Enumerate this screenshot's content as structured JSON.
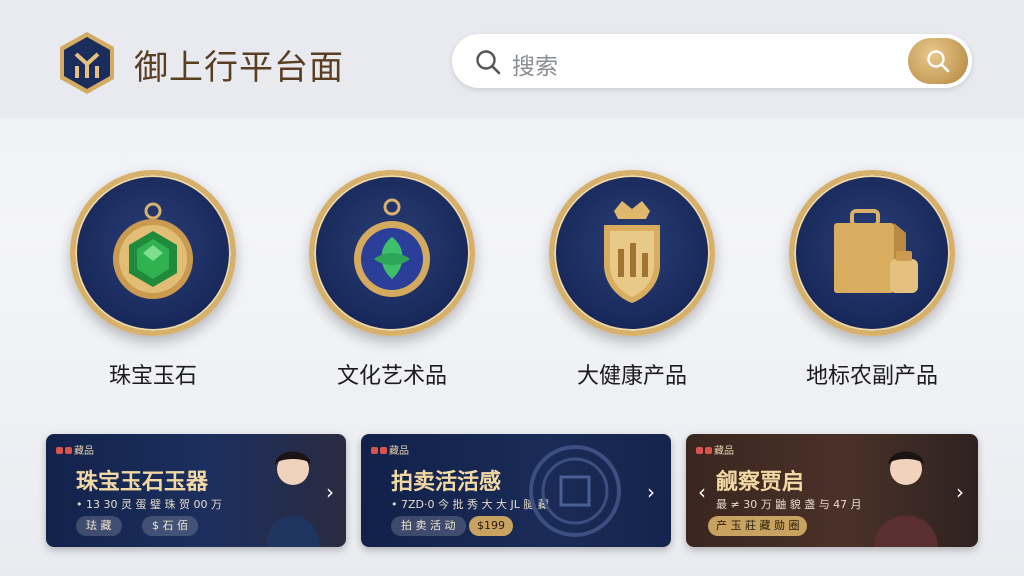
{
  "app": {
    "title": "御上行平台面"
  },
  "search": {
    "placeholder": "搜索"
  },
  "categories": [
    {
      "label": "珠宝玉石",
      "icon": "jade-pendant-icon"
    },
    {
      "label": "文化艺术品",
      "icon": "leaf-medallion-icon"
    },
    {
      "label": "大健康产品",
      "icon": "crown-shield-icon"
    },
    {
      "label": "地标农副产品",
      "icon": "gift-box-jar-icon"
    }
  ],
  "promos": [
    {
      "tag": "藏品",
      "title": "珠宝玉石玉器",
      "subtitle": "• 13 30 灵 蛋 璧 珠 贺 00 万",
      "button": "珐 藏",
      "button2": "$ 石 佰"
    },
    {
      "tag": "藏品",
      "title": "拍卖活活感",
      "subtitle": "• 7ZD·0 今 批 秀 大 大 JL 腿 藏",
      "button": "拍 卖 活 动",
      "button2": "$199"
    },
    {
      "tag": "藏品",
      "title": "觎察贾启",
      "subtitle": "最 ≠ 30 万 鼬 貌 盏 与 47 月",
      "button": "产 玉 莊 藏 勋 圈"
    }
  ],
  "colors": {
    "gold": "#d7b06a",
    "navy": "#18285a",
    "title_brown": "#5a3e24"
  }
}
